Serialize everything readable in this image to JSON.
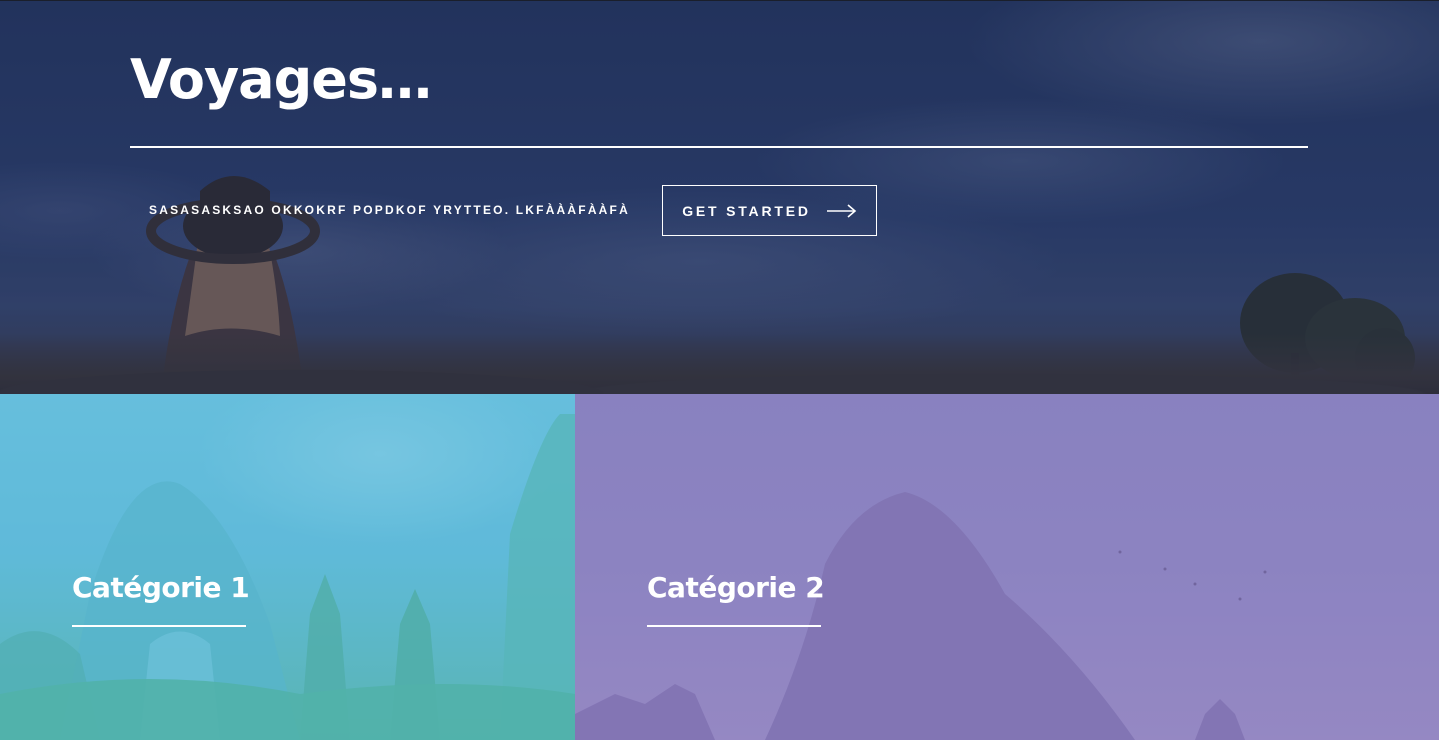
{
  "hero": {
    "title": "Voyages…",
    "tagline": "SASASASKSAO OKKOKRF POPDKOF YRYTTEO. LKFÀÀÀFÀÀFÀ",
    "cta_label": "GET STARTED",
    "cta_icon": "arrow-right-icon"
  },
  "categories": [
    {
      "title": "Catégorie 1",
      "overlay_color": "#62bedc"
    },
    {
      "title": "Catégorie 2",
      "overlay_color": "#8c82c3"
    }
  ],
  "colors": {
    "hero_overlay": "#1f2d5a",
    "text": "#ffffff"
  }
}
